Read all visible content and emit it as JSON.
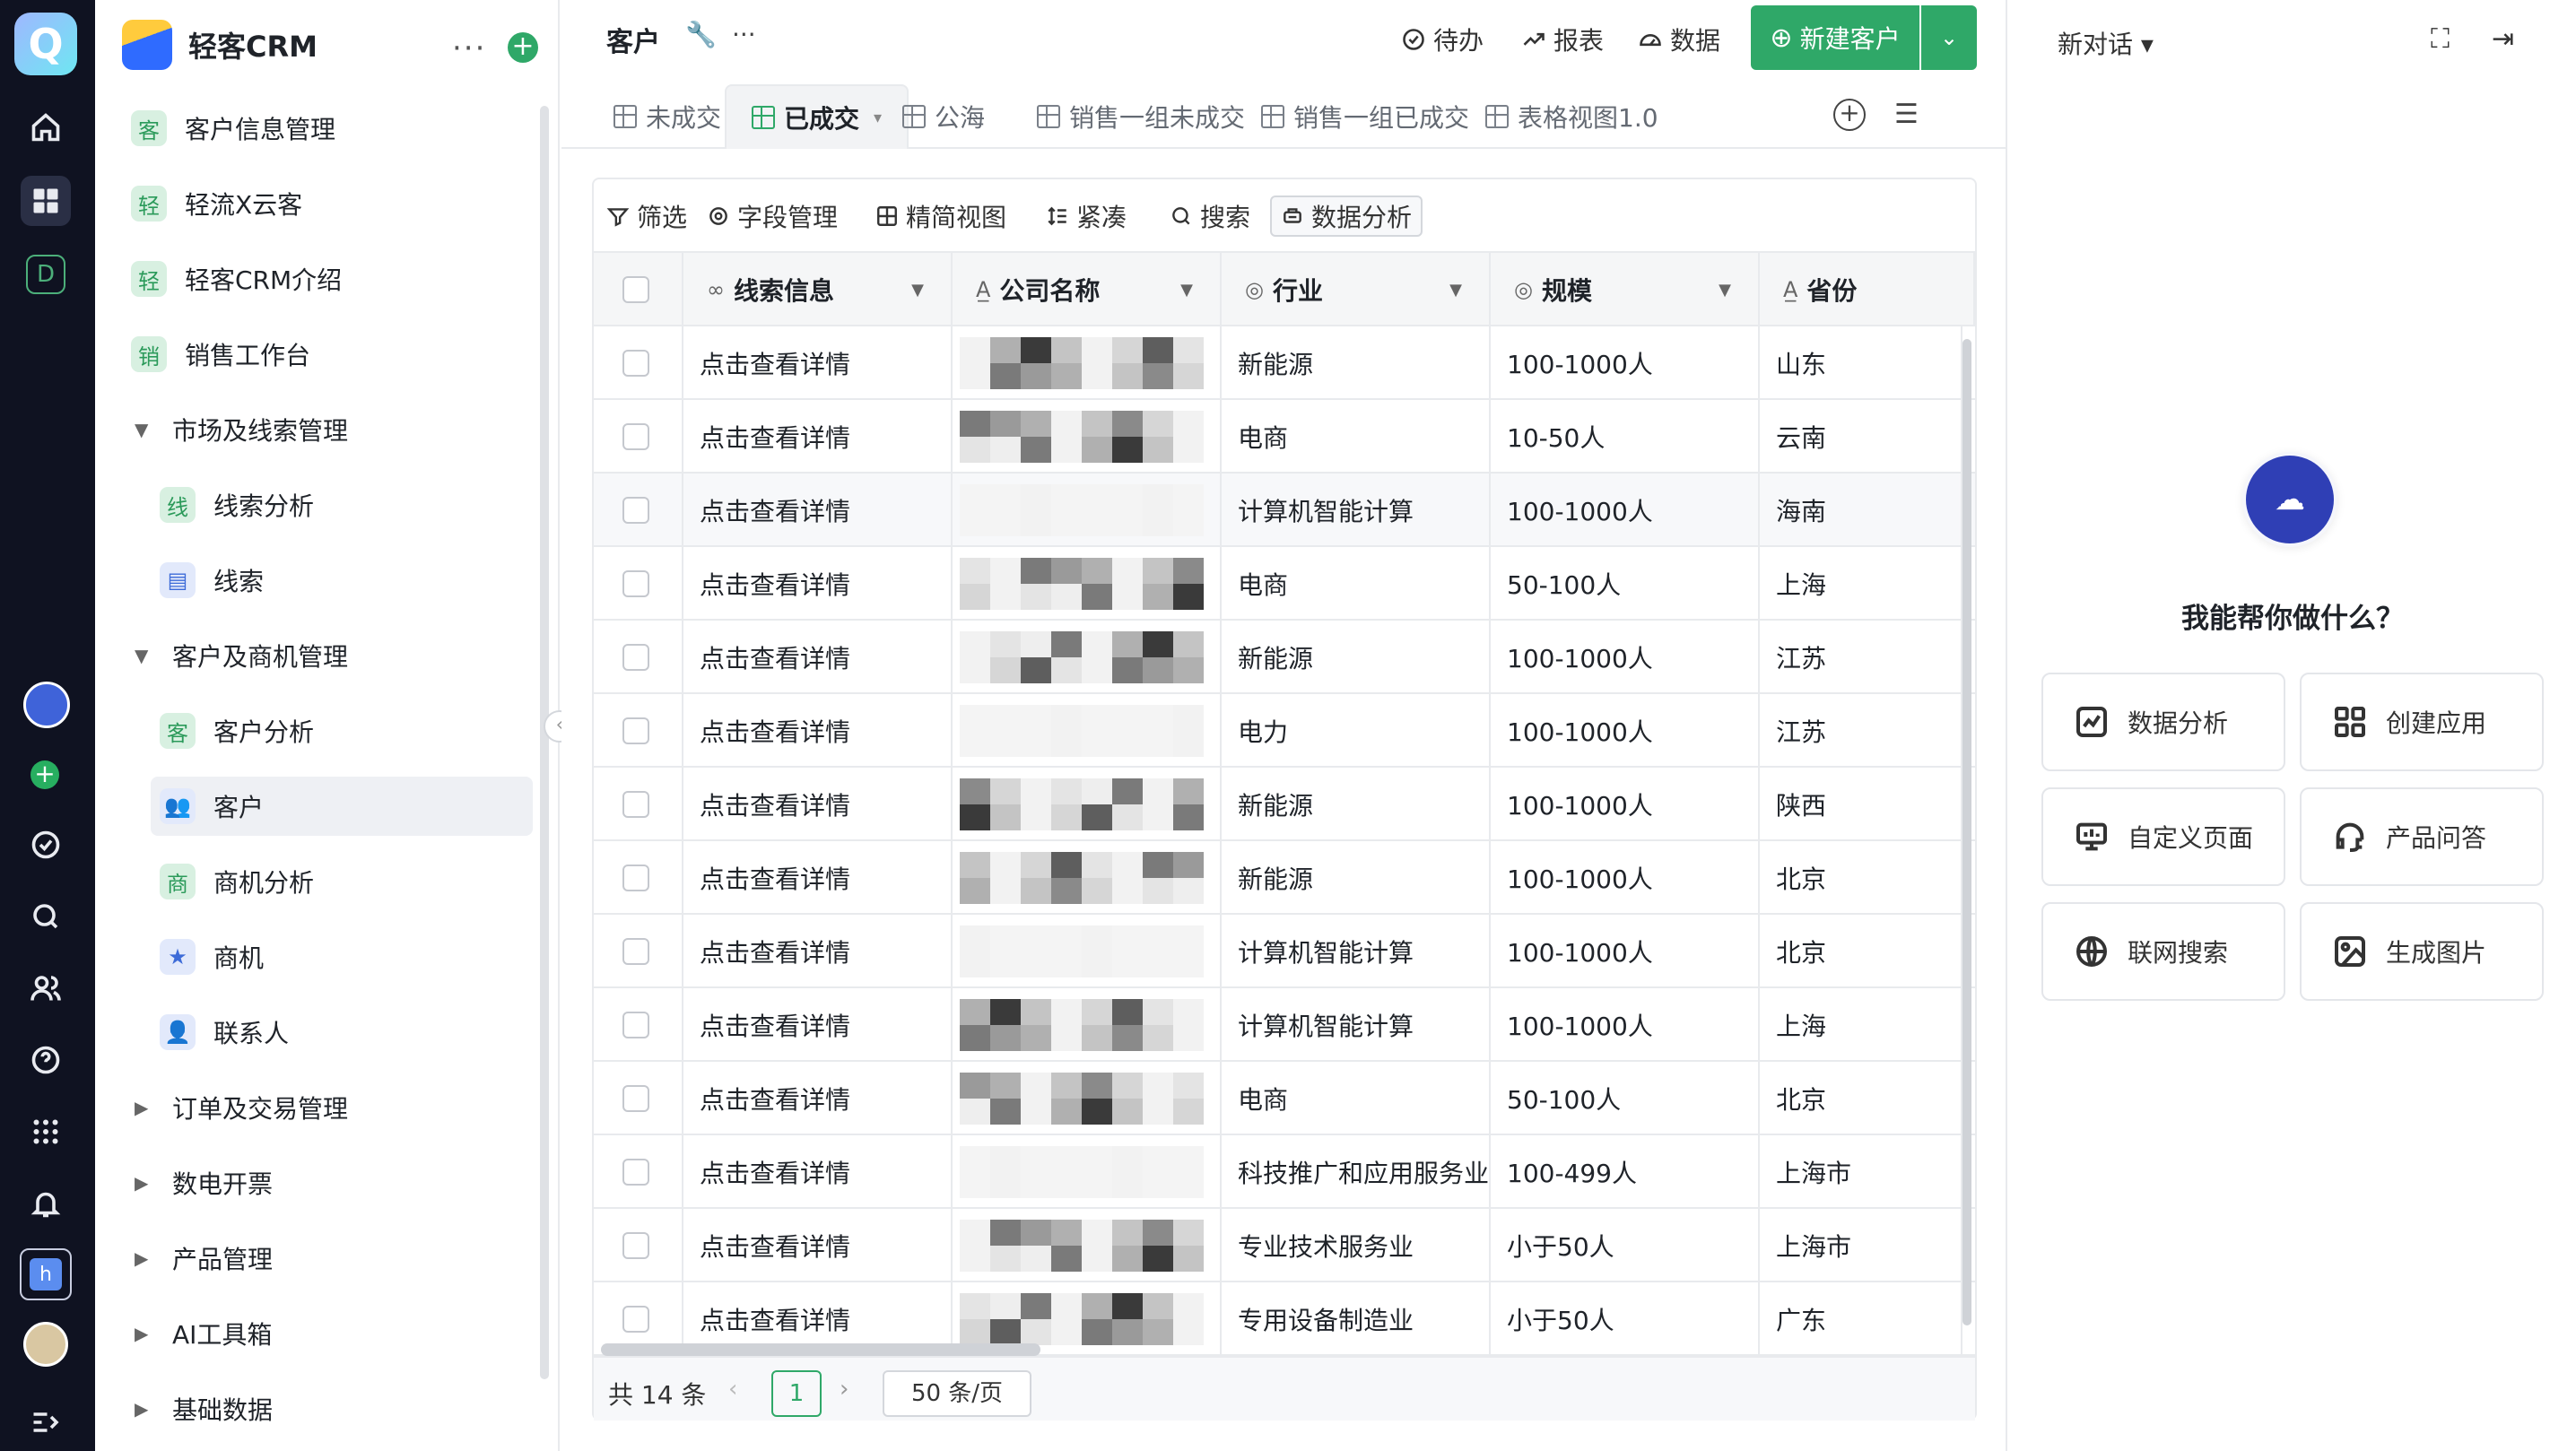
{
  "rail": {
    "logo": "Q",
    "d_badge": "D",
    "h_badge": "h",
    "plus": "+"
  },
  "nav": {
    "brand": "轻客CRM",
    "more": "···",
    "add": "+",
    "collapse": "‹",
    "items": [
      {
        "label": "客户信息管理",
        "badge": "客",
        "type": "app"
      },
      {
        "label": "轻流X云客",
        "badge": "轻",
        "type": "app"
      },
      {
        "label": "轻客CRM介绍",
        "badge": "轻",
        "type": "app"
      },
      {
        "label": "销售工作台",
        "badge": "销",
        "type": "app"
      },
      {
        "label": "市场及线索管理",
        "arrow": "▼",
        "type": "group"
      },
      {
        "label": "线索分析",
        "badge": "线",
        "type": "sub"
      },
      {
        "label": "线索",
        "badge": "▤",
        "type": "sub",
        "badge_color": "blue"
      },
      {
        "label": "客户及商机管理",
        "arrow": "▼",
        "type": "group"
      },
      {
        "label": "客户分析",
        "badge": "客",
        "type": "sub"
      },
      {
        "label": "客户",
        "badge": "👥",
        "type": "sub",
        "badge_color": "blue",
        "active": true
      },
      {
        "label": "商机分析",
        "badge": "商",
        "type": "sub"
      },
      {
        "label": "商机",
        "badge": "★",
        "type": "sub",
        "badge_color": "blue"
      },
      {
        "label": "联系人",
        "badge": "👤",
        "type": "sub",
        "badge_color": "blue"
      },
      {
        "label": "订单及交易管理",
        "arrow": "▶",
        "type": "group"
      },
      {
        "label": "数电开票",
        "arrow": "▶",
        "type": "group"
      },
      {
        "label": "产品管理",
        "arrow": "▶",
        "type": "group"
      },
      {
        "label": "AI工具箱",
        "arrow": "▶",
        "type": "group"
      },
      {
        "label": "基础数据",
        "arrow": "▶",
        "type": "group"
      }
    ]
  },
  "main": {
    "title": "客户",
    "title_tools": [
      "🔧",
      "···"
    ],
    "links": [
      {
        "label": "待办",
        "icon": "check-circle-icon"
      },
      {
        "label": "报表",
        "icon": "chart-line-icon"
      },
      {
        "label": "数据",
        "icon": "dashboard-icon"
      }
    ],
    "new_button": "新建客户",
    "new_plus": "⊕",
    "new_drop": "⌄",
    "tabs": [
      {
        "label": "未成交",
        "active": false
      },
      {
        "label": "已成交",
        "active": true
      },
      {
        "label": "公海",
        "active": false
      },
      {
        "label": "销售一组未成交",
        "active": false
      },
      {
        "label": "销售一组已成交",
        "active": false
      },
      {
        "label": "表格视图1.0",
        "active": false
      }
    ],
    "tab_caret": "▾",
    "tab_add": "+",
    "tab_list": "☰",
    "toolbar": [
      {
        "label": "筛选",
        "icon": "filter-icon"
      },
      {
        "label": "字段管理",
        "icon": "field-settings-icon"
      },
      {
        "label": "精简视图",
        "icon": "compact-view-icon"
      },
      {
        "label": "紧凑",
        "icon": "row-height-icon"
      },
      {
        "label": "搜索",
        "icon": "search-icon"
      },
      {
        "label": "数据分析",
        "icon": "data-analysis-icon",
        "boxed": true
      }
    ],
    "columns": [
      {
        "label": "线索信息",
        "icon": "∞"
      },
      {
        "label": "公司名称",
        "icon": "A̲"
      },
      {
        "label": "行业",
        "icon": "◎"
      },
      {
        "label": "规模",
        "icon": "◎"
      },
      {
        "label": "省份",
        "icon": "A̲"
      }
    ],
    "rows": [
      {
        "lead": "点击查看详情",
        "industry": "新能源",
        "scale": "100-1000人",
        "province": "山东"
      },
      {
        "lead": "点击查看详情",
        "industry": "电商",
        "scale": "10-50人",
        "province": "云南"
      },
      {
        "lead": "点击查看详情",
        "industry": "计算机智能计算",
        "scale": "100-1000人",
        "province": "海南"
      },
      {
        "lead": "点击查看详情",
        "industry": "电商",
        "scale": "50-100人",
        "province": "上海"
      },
      {
        "lead": "点击查看详情",
        "industry": "新能源",
        "scale": "100-1000人",
        "province": "江苏"
      },
      {
        "lead": "点击查看详情",
        "industry": "电力",
        "scale": "100-1000人",
        "province": "江苏"
      },
      {
        "lead": "点击查看详情",
        "industry": "新能源",
        "scale": "100-1000人",
        "province": "陕西"
      },
      {
        "lead": "点击查看详情",
        "industry": "新能源",
        "scale": "100-1000人",
        "province": "北京"
      },
      {
        "lead": "点击查看详情",
        "industry": "计算机智能计算",
        "scale": "100-1000人",
        "province": "北京"
      },
      {
        "lead": "点击查看详情",
        "industry": "计算机智能计算",
        "scale": "100-1000人",
        "province": "上海"
      },
      {
        "lead": "点击查看详情",
        "industry": "电商",
        "scale": "50-100人",
        "province": "北京"
      },
      {
        "lead": "点击查看详情",
        "industry": "科技推广和应用服务业",
        "scale": "100-499人",
        "province": "上海市"
      },
      {
        "lead": "点击查看详情",
        "industry": "专业技术服务业",
        "scale": "小于50人",
        "province": "上海市"
      },
      {
        "lead": "点击查看详情",
        "industry": "专用设备制造业",
        "scale": "小于50人",
        "province": "广东"
      }
    ],
    "pager": {
      "total": "共 14 条",
      "prev": "‹",
      "page": "1",
      "next": "›",
      "size": "50 条/页"
    }
  },
  "assistant": {
    "title": "新对话 ▾",
    "expand": "⛶",
    "collapse": "⇥",
    "question": "我能帮你做什么？",
    "cards": [
      {
        "label": "数据分析",
        "icon": "chart-icon"
      },
      {
        "label": "创建应用",
        "icon": "apps-icon"
      },
      {
        "label": "自定义页面",
        "icon": "monitor-icon"
      },
      {
        "label": "产品问答",
        "icon": "headset-icon"
      },
      {
        "label": "联网搜索",
        "icon": "globe-icon"
      },
      {
        "label": "生成图片",
        "icon": "image-icon"
      }
    ]
  },
  "colors": {
    "brand_green": "#2fa868",
    "rail_bg": "#0f1221",
    "bot_blue": "#2f3fb5"
  }
}
